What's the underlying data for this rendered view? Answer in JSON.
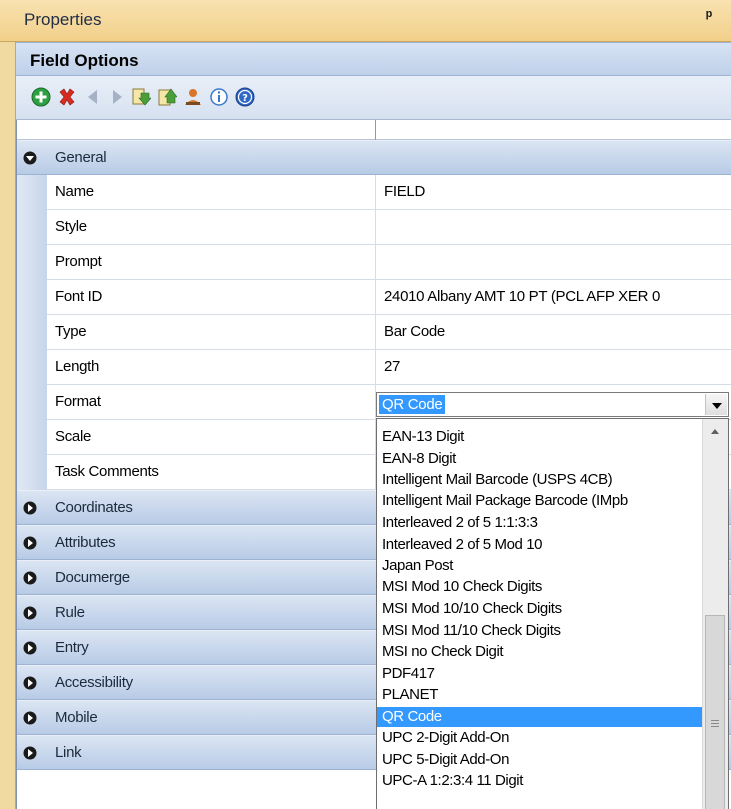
{
  "panel": {
    "title": "Properties",
    "pin_glyph": "ᵖ"
  },
  "field_options": {
    "title": "Field Options"
  },
  "toolbar": {
    "buttons": [
      {
        "name": "add-icon",
        "color": "#2ea043"
      },
      {
        "name": "delete-icon",
        "color": "#d62b1f"
      },
      {
        "name": "arrow-left-icon",
        "color": "#a5b1c4"
      },
      {
        "name": "arrow-right-icon",
        "color": "#a5b1c4"
      },
      {
        "name": "move-down-icon",
        "color": "#4a9f3a"
      },
      {
        "name": "move-up-icon",
        "color": "#4a9f3a"
      },
      {
        "name": "user-icon",
        "color": "#d9762b"
      },
      {
        "name": "info-icon",
        "color": "#3a79c9"
      },
      {
        "name": "help-icon",
        "color": "#2f67c4"
      }
    ]
  },
  "general": {
    "label": "General",
    "rows": [
      {
        "name": "Name",
        "value": "FIELD"
      },
      {
        "name": "Style",
        "value": ""
      },
      {
        "name": "Prompt",
        "value": ""
      },
      {
        "name": "Font ID",
        "value": "24010 Albany AMT 10 PT (PCL AFP XER 0"
      },
      {
        "name": "Type",
        "value": "Bar Code"
      },
      {
        "name": "Length",
        "value": "27"
      },
      {
        "name": "Format",
        "value": "QR Code"
      },
      {
        "name": "Scale",
        "value": ""
      },
      {
        "name": "Task Comments",
        "value": ""
      }
    ]
  },
  "categories": [
    "Coordinates",
    "Attributes",
    "Documerge",
    "Rule",
    "Entry",
    "Accessibility",
    "Mobile",
    "Link"
  ],
  "dropdown": {
    "items": [
      "EAN-13 Digit",
      "EAN-8 Digit",
      "Intelligent Mail Barcode (USPS 4CB)",
      "Intelligent Mail Package Barcode (IMpb",
      "Interleaved 2 of 5 1:1:3:3",
      "Interleaved 2 of 5 Mod 10",
      "Japan Post",
      "MSI Mod 10 Check Digits",
      "MSI Mod 10/10 Check Digits",
      "MSI Mod 11/10 Check Digits",
      "MSI no Check Digit",
      "PDF417",
      "PLANET",
      "QR Code",
      "UPC 2-Digit Add-On",
      "UPC 5-Digit Add-On",
      "UPC-A 1:2:3:4 11 Digit"
    ],
    "selected": "QR Code"
  },
  "colors": {
    "selection": "#3399ff",
    "header": "#f2d08a",
    "category": "#c5d5ec"
  }
}
